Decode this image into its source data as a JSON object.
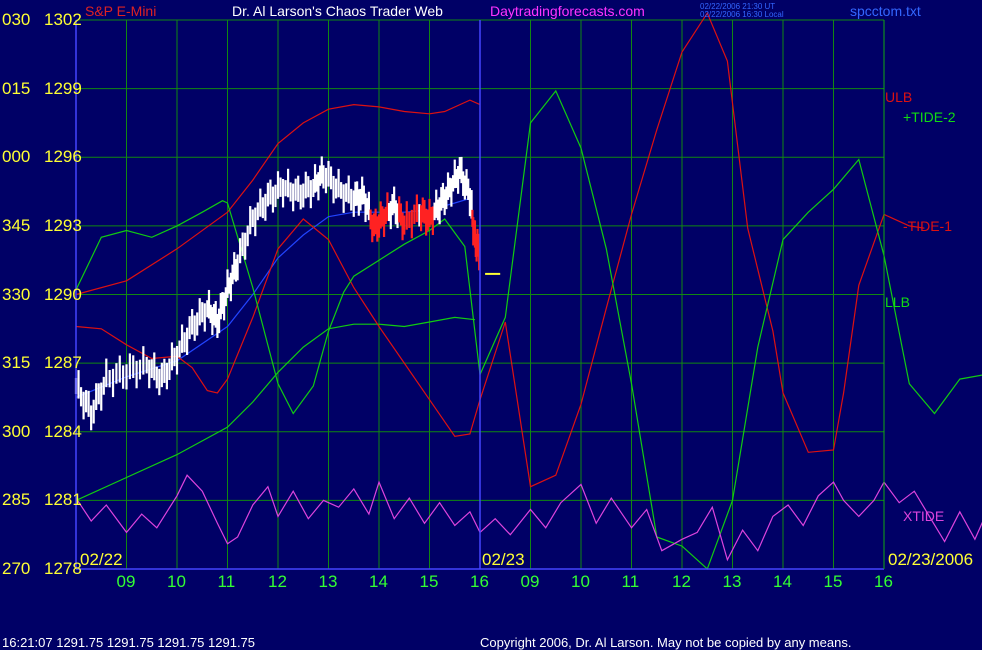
{
  "header": {
    "instrument": "S&P E-Mini",
    "title": "Dr. Al Larson's Chaos Trader Web",
    "site": "Daytradingforecasts.com",
    "ut_stamp": "02/22/2006 21:30 UT",
    "local_stamp": "02/22/2006 16:30 Local",
    "file": "spcctom.txt"
  },
  "footer": {
    "quote": "16:21:07  1291.75  1291.75  1291.75  1291.75",
    "copyright": "Copyright 2006, Dr. Al Larson. May not be copied by any means."
  },
  "colors": {
    "background": "#000066",
    "grid": "#118811",
    "axis": "#4444ff",
    "price_up": "#ffffff",
    "price_down": "#ff2222",
    "red_line": "#dd1111",
    "green_line": "#11cc11",
    "magenta_line": "#dd44dd",
    "blue_line": "#2244ff"
  },
  "chart_data": {
    "type": "line",
    "y_axis": {
      "degree_labels": [
        "030",
        "015",
        "000",
        "345",
        "330",
        "315",
        "300",
        "285",
        "270"
      ],
      "price_labels": [
        "1302",
        "1299",
        "1296",
        "1293",
        "1290",
        "1287",
        "1284",
        "1281",
        "1278"
      ],
      "ylim": [
        1278,
        1302
      ]
    },
    "x_axis": {
      "ticks": [
        "09",
        "10",
        "11",
        "12",
        "13",
        "14",
        "15",
        "16",
        "09",
        "10",
        "11",
        "12",
        "13",
        "14",
        "15",
        "16"
      ],
      "date_labels": [
        "02/22",
        "02/23",
        "02/23/2006"
      ],
      "hour_range": [
        8,
        24
      ]
    },
    "grid": true,
    "series_labels": {
      "ulb": "ULB",
      "tide2": "+TIDE-2",
      "tide1": "-TIDE-1",
      "llb": "LLB",
      "xtide": "XTIDE"
    },
    "series": [
      {
        "key": "price",
        "values": [
          [
            8.0,
            1286.0
          ],
          [
            8.3,
            1284.8
          ],
          [
            8.6,
            1286.3
          ],
          [
            9.0,
            1286.6
          ],
          [
            9.4,
            1286.9
          ],
          [
            9.7,
            1286.3
          ],
          [
            10.0,
            1287.4
          ],
          [
            10.3,
            1288.6
          ],
          [
            10.6,
            1289.4
          ],
          [
            10.8,
            1288.8
          ],
          [
            11.0,
            1290.2
          ],
          [
            11.2,
            1291.4
          ],
          [
            11.5,
            1293.3
          ],
          [
            11.8,
            1294.2
          ],
          [
            12.1,
            1294.7
          ],
          [
            12.4,
            1294.4
          ],
          [
            12.7,
            1294.7
          ],
          [
            12.9,
            1295.3
          ],
          [
            13.2,
            1294.6
          ],
          [
            13.5,
            1294.2
          ],
          [
            13.7,
            1294.3
          ],
          [
            13.9,
            1292.9
          ],
          [
            14.1,
            1293.4
          ],
          [
            14.3,
            1293.9
          ],
          [
            14.5,
            1293.1
          ],
          [
            14.8,
            1293.6
          ],
          [
            15.0,
            1293.3
          ],
          [
            15.2,
            1293.9
          ],
          [
            15.4,
            1294.6
          ],
          [
            15.6,
            1295.4
          ],
          [
            15.8,
            1294.3
          ],
          [
            15.9,
            1292.4
          ],
          [
            16.0,
            1291.8
          ]
        ]
      },
      {
        "key": "ma",
        "values": [
          [
            8.0,
            1285.5
          ],
          [
            9.0,
            1286.4
          ],
          [
            10.0,
            1287.1
          ],
          [
            11.0,
            1288.6
          ],
          [
            11.5,
            1290.0
          ],
          [
            12.0,
            1291.6
          ],
          [
            12.5,
            1292.6
          ],
          [
            13.0,
            1293.4
          ],
          [
            13.5,
            1293.6
          ],
          [
            14.0,
            1293.6
          ],
          [
            14.5,
            1293.6
          ],
          [
            15.0,
            1293.7
          ],
          [
            15.5,
            1294.0
          ],
          [
            15.8,
            1294.2
          ]
        ]
      },
      {
        "key": "ulb",
        "values": [
          [
            8.0,
            1290.0
          ],
          [
            9.0,
            1290.6
          ],
          [
            10.0,
            1292.0
          ],
          [
            11.0,
            1293.6
          ],
          [
            11.5,
            1295.0
          ],
          [
            12.0,
            1296.6
          ],
          [
            12.5,
            1297.5
          ],
          [
            13.0,
            1298.1
          ],
          [
            13.5,
            1298.3
          ],
          [
            14.0,
            1298.2
          ],
          [
            14.5,
            1298.0
          ],
          [
            15.0,
            1297.9
          ],
          [
            15.3,
            1298.0
          ],
          [
            15.8,
            1298.5
          ],
          [
            16.0,
            1298.3
          ]
        ]
      },
      {
        "key": "llb",
        "values": [
          [
            8.0,
            1281.0
          ],
          [
            9.0,
            1282.0
          ],
          [
            10.0,
            1283.0
          ],
          [
            11.0,
            1284.2
          ],
          [
            11.5,
            1285.3
          ],
          [
            12.0,
            1286.6
          ],
          [
            12.5,
            1287.7
          ],
          [
            13.0,
            1288.5
          ],
          [
            13.5,
            1288.7
          ],
          [
            14.0,
            1288.7
          ],
          [
            14.5,
            1288.6
          ],
          [
            15.0,
            1288.8
          ],
          [
            15.5,
            1289.0
          ],
          [
            15.9,
            1288.9
          ]
        ]
      },
      {
        "key": "red",
        "values": [
          [
            8.0,
            1288.6
          ],
          [
            8.5,
            1288.5
          ],
          [
            9.0,
            1287.8
          ],
          [
            9.5,
            1287.2
          ],
          [
            10.0,
            1287.3
          ],
          [
            10.3,
            1286.8
          ],
          [
            10.6,
            1285.8
          ],
          [
            10.8,
            1285.7
          ],
          [
            11.0,
            1286.3
          ],
          [
            11.5,
            1289.0
          ],
          [
            12.0,
            1292.0
          ],
          [
            12.5,
            1293.3
          ],
          [
            13.0,
            1292.4
          ],
          [
            13.5,
            1290.3
          ],
          [
            14.0,
            1288.6
          ],
          [
            14.5,
            1287.0
          ],
          [
            15.0,
            1285.4
          ],
          [
            15.5,
            1283.8
          ],
          [
            15.8,
            1283.9
          ],
          [
            16.0,
            1285.4
          ],
          [
            16.5,
            1288.8
          ],
          [
            17.0,
            1281.6
          ],
          [
            17.5,
            1282.1
          ],
          [
            18.0,
            1285.2
          ],
          [
            18.5,
            1289.4
          ],
          [
            19.0,
            1293.5
          ],
          [
            19.5,
            1297.2
          ],
          [
            20.0,
            1300.6
          ],
          [
            20.5,
            1302.3
          ],
          [
            20.9,
            1300.2
          ],
          [
            21.3,
            1292.9
          ],
          [
            21.8,
            1288.4
          ],
          [
            22.0,
            1285.7
          ],
          [
            22.5,
            1283.1
          ],
          [
            23.0,
            1283.2
          ],
          [
            23.2,
            1285.7
          ],
          [
            23.5,
            1290.4
          ],
          [
            24.0,
            1293.5
          ],
          [
            24.5,
            1293.0
          ],
          [
            24.8,
            1292.9
          ]
        ]
      },
      {
        "key": "green",
        "values": [
          [
            8.0,
            1290.2
          ],
          [
            8.5,
            1292.5
          ],
          [
            9.0,
            1292.8
          ],
          [
            9.5,
            1292.5
          ],
          [
            10.0,
            1293.0
          ],
          [
            10.5,
            1293.6
          ],
          [
            10.9,
            1294.1
          ],
          [
            11.0,
            1294.0
          ],
          [
            11.5,
            1290.3
          ],
          [
            12.0,
            1286.1
          ],
          [
            12.3,
            1284.8
          ],
          [
            12.7,
            1286.0
          ],
          [
            13.0,
            1288.4
          ],
          [
            13.3,
            1290.1
          ],
          [
            13.5,
            1290.8
          ],
          [
            14.0,
            1291.5
          ],
          [
            14.5,
            1292.2
          ],
          [
            15.0,
            1292.8
          ],
          [
            15.3,
            1293.3
          ],
          [
            15.7,
            1292.1
          ],
          [
            16.0,
            1286.5
          ],
          [
            16.5,
            1289.0
          ],
          [
            17.0,
            1297.5
          ],
          [
            17.5,
            1298.9
          ],
          [
            18.0,
            1296.4
          ],
          [
            18.5,
            1292.0
          ],
          [
            19.0,
            1286.1
          ],
          [
            19.5,
            1279.4
          ],
          [
            20.0,
            1279.0
          ],
          [
            20.5,
            1278.0
          ],
          [
            21.0,
            1281.0
          ],
          [
            21.5,
            1287.7
          ],
          [
            22.0,
            1292.4
          ],
          [
            22.5,
            1293.6
          ],
          [
            23.0,
            1294.6
          ],
          [
            23.5,
            1295.9
          ],
          [
            24.0,
            1291.7
          ],
          [
            24.5,
            1286.1
          ],
          [
            25.0,
            1284.8
          ],
          [
            25.5,
            1286.3
          ],
          [
            26.0,
            1286.5
          ],
          [
            26.3,
            1292.2
          ]
        ]
      },
      {
        "key": "xtide",
        "values": [
          [
            8.0,
            1281.1
          ],
          [
            8.3,
            1280.1
          ],
          [
            8.6,
            1280.8
          ],
          [
            9.0,
            1279.6
          ],
          [
            9.3,
            1280.4
          ],
          [
            9.6,
            1279.8
          ],
          [
            10.0,
            1281.2
          ],
          [
            10.2,
            1282.1
          ],
          [
            10.5,
            1281.4
          ],
          [
            10.8,
            1280.0
          ],
          [
            11.0,
            1279.1
          ],
          [
            11.2,
            1279.4
          ],
          [
            11.5,
            1280.8
          ],
          [
            11.8,
            1281.6
          ],
          [
            12.0,
            1280.3
          ],
          [
            12.3,
            1281.4
          ],
          [
            12.6,
            1280.2
          ],
          [
            12.9,
            1281.0
          ],
          [
            13.2,
            1280.7
          ],
          [
            13.5,
            1281.5
          ],
          [
            13.8,
            1280.4
          ],
          [
            14.0,
            1281.8
          ],
          [
            14.3,
            1280.2
          ],
          [
            14.6,
            1281.1
          ],
          [
            14.9,
            1280.0
          ],
          [
            15.2,
            1280.9
          ],
          [
            15.5,
            1279.9
          ],
          [
            15.8,
            1280.5
          ],
          [
            16.0,
            1279.6
          ],
          [
            16.3,
            1280.2
          ],
          [
            16.6,
            1279.5
          ],
          [
            17.0,
            1280.6
          ],
          [
            17.3,
            1279.8
          ],
          [
            17.6,
            1280.9
          ],
          [
            18.0,
            1281.7
          ],
          [
            18.3,
            1280.0
          ],
          [
            18.6,
            1281.1
          ],
          [
            19.0,
            1279.8
          ],
          [
            19.3,
            1280.6
          ],
          [
            19.6,
            1278.8
          ],
          [
            20.0,
            1279.3
          ],
          [
            20.3,
            1279.6
          ],
          [
            20.6,
            1280.7
          ],
          [
            20.9,
            1278.4
          ],
          [
            21.2,
            1279.7
          ],
          [
            21.5,
            1278.8
          ],
          [
            21.8,
            1280.3
          ],
          [
            22.1,
            1280.8
          ],
          [
            22.4,
            1279.9
          ],
          [
            22.7,
            1281.2
          ],
          [
            23.0,
            1281.8
          ],
          [
            23.2,
            1281.0
          ],
          [
            23.5,
            1280.3
          ],
          [
            23.8,
            1281.0
          ],
          [
            24.0,
            1281.8
          ],
          [
            24.3,
            1280.9
          ],
          [
            24.6,
            1281.4
          ],
          [
            24.9,
            1280.3
          ],
          [
            25.2,
            1279.2
          ],
          [
            25.5,
            1280.5
          ],
          [
            25.8,
            1279.3
          ],
          [
            26.0,
            1280.3
          ],
          [
            26.3,
            1280.1
          ]
        ]
      },
      {
        "key": "forecast_marker",
        "values": [
          [
            16.1,
            1290.9
          ],
          [
            16.4,
            1290.9
          ]
        ]
      }
    ]
  }
}
